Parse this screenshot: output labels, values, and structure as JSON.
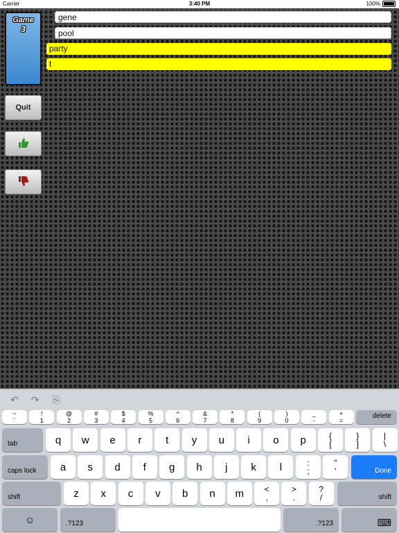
{
  "status": {
    "carrier": "Carrier",
    "time": "3:40 PM",
    "battery": "100%"
  },
  "game": {
    "label": "Game",
    "number": "3"
  },
  "buttons": {
    "quit": "Quit",
    "thumbs_up_color": "#2a9a2a",
    "thumbs_down_color": "#9a1c1c"
  },
  "words": [
    "gene",
    "pool",
    "party",
    "t"
  ],
  "toolbar": {
    "undo": "↶",
    "redo": "↷",
    "paste": "⎘"
  },
  "keyboard": {
    "row1": [
      [
        "~",
        "`"
      ],
      [
        "!",
        "1"
      ],
      [
        "@",
        "2"
      ],
      [
        "#",
        "3"
      ],
      [
        "$",
        "4"
      ],
      [
        "%",
        "5"
      ],
      [
        "^",
        "6"
      ],
      [
        "&",
        "7"
      ],
      [
        "*",
        "8"
      ],
      [
        "(",
        "9"
      ],
      [
        ")",
        "0"
      ],
      [
        "_",
        "-"
      ],
      [
        "+",
        "="
      ]
    ],
    "delete": "delete",
    "tab": "tab",
    "row2": [
      "q",
      "w",
      "e",
      "r",
      "t",
      "y",
      "u",
      "i",
      "o",
      "p"
    ],
    "row2_extra": [
      [
        "{",
        "["
      ],
      [
        "}",
        "]"
      ],
      [
        "|",
        "\\"
      ]
    ],
    "caps": "caps lock",
    "row3": [
      "a",
      "s",
      "d",
      "f",
      "g",
      "h",
      "j",
      "k",
      "l"
    ],
    "row3_extra": [
      [
        ":",
        ";"
      ],
      [
        "\"",
        "'"
      ]
    ],
    "done": "Done",
    "shift": "shift",
    "row4": [
      "z",
      "x",
      "c",
      "v",
      "b",
      "n",
      "m"
    ],
    "row4_extra": [
      [
        "<",
        ","
      ],
      [
        ">",
        "."
      ],
      [
        "?",
        "/"
      ]
    ],
    "emoji": "☺",
    "numbers": ".?123",
    "hide": "⌨"
  }
}
